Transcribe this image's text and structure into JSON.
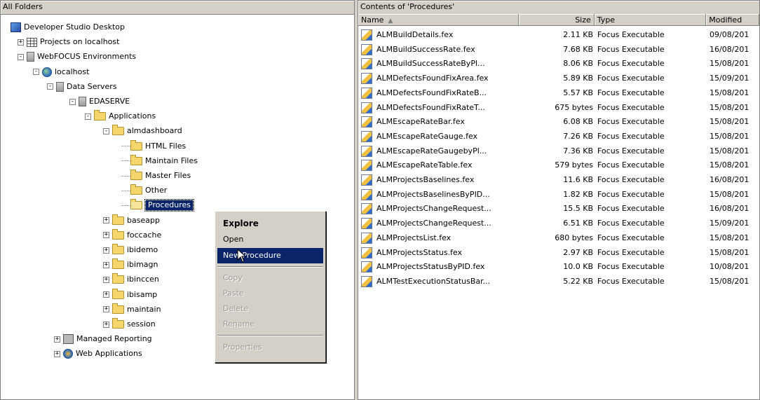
{
  "left_pane": {
    "title": "All Folders",
    "tree": [
      {
        "label": "Developer Studio Desktop",
        "icon": "desktop-icon"
      },
      {
        "label": "Projects on localhost",
        "icon": "grid-icon"
      },
      {
        "label": "WebFOCUS Environments",
        "icon": "server-icon"
      },
      {
        "label": "localhost",
        "icon": "globe-icon"
      },
      {
        "label": "Data Servers",
        "icon": "server-icon"
      },
      {
        "label": "EDASERVE",
        "icon": "server-icon"
      },
      {
        "label": "Applications",
        "icon": "folder-icon"
      },
      {
        "label": "almdashboard",
        "icon": "folder-icon"
      },
      {
        "label": "HTML Files",
        "icon": "folder-icon"
      },
      {
        "label": "Maintain Files",
        "icon": "folder-icon"
      },
      {
        "label": "Master Files",
        "icon": "folder-icon"
      },
      {
        "label": "Other",
        "icon": "folder-icon"
      },
      {
        "label": "Procedures",
        "icon": "open-folder-icon",
        "selected": true
      },
      {
        "label": "baseapp",
        "icon": "folder-icon"
      },
      {
        "label": "foccache",
        "icon": "folder-icon"
      },
      {
        "label": "ibidemo",
        "icon": "folder-icon"
      },
      {
        "label": "ibimagn",
        "icon": "folder-icon"
      },
      {
        "label": "ibinccen",
        "icon": "folder-icon"
      },
      {
        "label": "ibisamp",
        "icon": "folder-icon"
      },
      {
        "label": "maintain",
        "icon": "folder-icon"
      },
      {
        "label": "session",
        "icon": "folder-icon"
      },
      {
        "label": "Managed Reporting",
        "icon": "report-icon"
      },
      {
        "label": "Web Applications",
        "icon": "webapp-icon"
      }
    ]
  },
  "right_pane": {
    "title": "Contents of 'Procedures'",
    "columns": {
      "name": "Name",
      "size": "Size",
      "type": "Type",
      "modified": "Modified"
    },
    "rows": [
      {
        "name": "ALMBuildDetails.fex",
        "size": "2.11 KB",
        "type": "Focus Executable",
        "modified": "09/08/201"
      },
      {
        "name": "ALMBuildSuccessRate.fex",
        "size": "7.68 KB",
        "type": "Focus Executable",
        "modified": "16/08/201"
      },
      {
        "name": "ALMBuildSuccessRateByPl...",
        "size": "8.06 KB",
        "type": "Focus Executable",
        "modified": "15/08/201"
      },
      {
        "name": "ALMDefectsFoundFixArea.fex",
        "size": "5.89 KB",
        "type": "Focus Executable",
        "modified": "15/09/201"
      },
      {
        "name": "ALMDefectsFoundFixRateB...",
        "size": "5.57 KB",
        "type": "Focus Executable",
        "modified": "15/08/201"
      },
      {
        "name": "ALMDefectsFoundFixRateT...",
        "size": "675 bytes",
        "type": "Focus Executable",
        "modified": "15/08/201"
      },
      {
        "name": "ALMEscapeRateBar.fex",
        "size": "6.08 KB",
        "type": "Focus Executable",
        "modified": "15/08/201"
      },
      {
        "name": "ALMEscapeRateGauge.fex",
        "size": "7.26 KB",
        "type": "Focus Executable",
        "modified": "15/08/201"
      },
      {
        "name": "ALMEscapeRateGaugebyPl...",
        "size": "7.36 KB",
        "type": "Focus Executable",
        "modified": "15/08/201"
      },
      {
        "name": "ALMEscapeRateTable.fex",
        "size": "579 bytes",
        "type": "Focus Executable",
        "modified": "15/08/201"
      },
      {
        "name": "ALMProjectsBaselines.fex",
        "size": "11.6 KB",
        "type": "Focus Executable",
        "modified": "16/08/201"
      },
      {
        "name": "ALMProjectsBaselinesByPID...",
        "size": "1.82 KB",
        "type": "Focus Executable",
        "modified": "15/08/201"
      },
      {
        "name": "ALMProjectsChangeRequest...",
        "size": "15.5 KB",
        "type": "Focus Executable",
        "modified": "16/08/201"
      },
      {
        "name": "ALMProjectsChangeRequest...",
        "size": "6.51 KB",
        "type": "Focus Executable",
        "modified": "15/09/201"
      },
      {
        "name": "ALMProjectsList.fex",
        "size": "680 bytes",
        "type": "Focus Executable",
        "modified": "15/08/201"
      },
      {
        "name": "ALMProjectsStatus.fex",
        "size": "2.97 KB",
        "type": "Focus Executable",
        "modified": "15/08/201"
      },
      {
        "name": "ALMProjectsStatusByPID.fex",
        "size": "10.0 KB",
        "type": "Focus Executable",
        "modified": "10/08/201"
      },
      {
        "name": "ALMTestExecutionStatusBar...",
        "size": "5.22 KB",
        "type": "Focus Executable",
        "modified": "15/08/201"
      }
    ]
  },
  "context_menu": {
    "explore": "Explore",
    "open": "Open",
    "new_procedure": "New Procedure",
    "copy": "Copy",
    "paste": "Paste",
    "delete": "Delete",
    "rename": "Rename",
    "properties": "Properties"
  },
  "colors": {
    "selection": "#0a246a",
    "chrome": "#d4d0c8"
  }
}
